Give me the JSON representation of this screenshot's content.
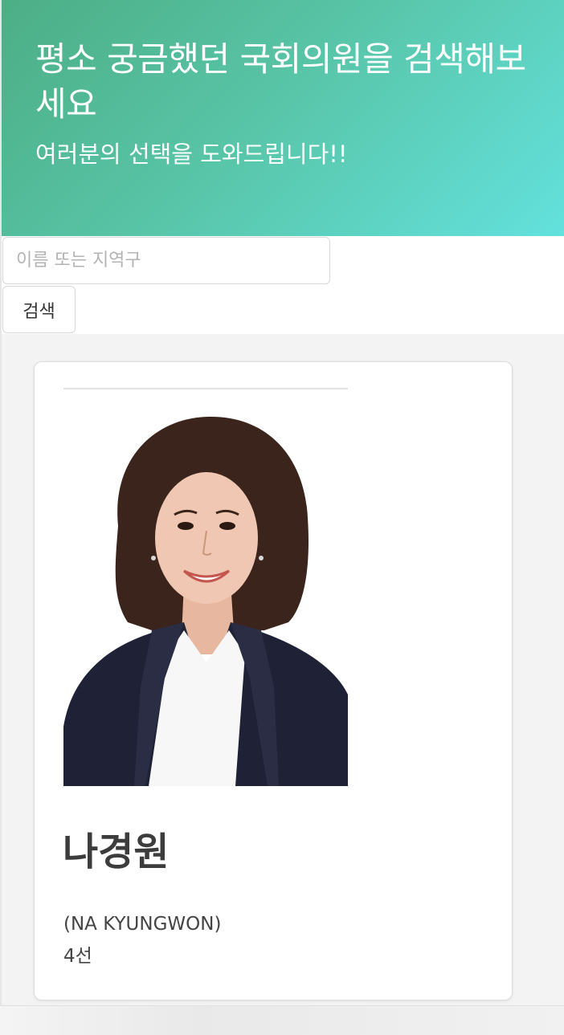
{
  "hero": {
    "title": "평소 궁금했던 국회의원을 검색해보세요",
    "subtitle": "여러분의 선택을 도와드립니다!!",
    "gradient_colors": [
      "#4cae85",
      "#63e1dd"
    ]
  },
  "search": {
    "placeholder": "이름 또는 지역구",
    "value": "",
    "button_label": "검색"
  },
  "results": [
    {
      "name": "나경원",
      "name_en": "(NA KYUNGWON)",
      "terms": "4선",
      "photo": "politician-portrait-photo"
    }
  ]
}
